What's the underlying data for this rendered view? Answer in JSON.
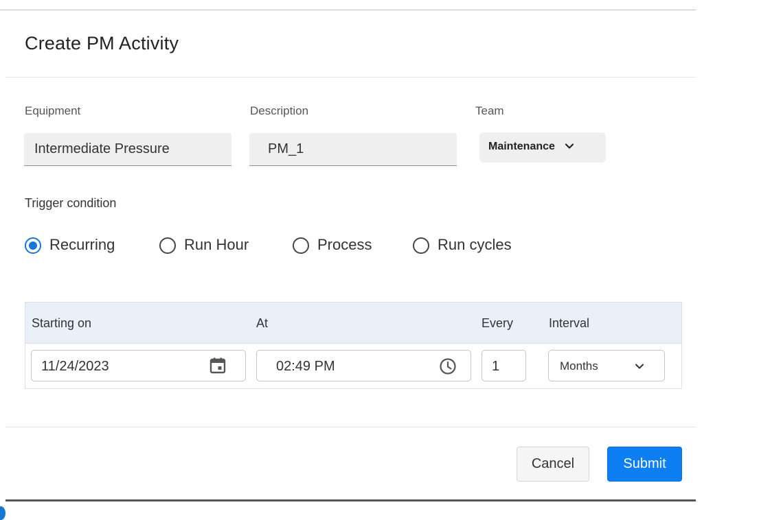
{
  "dialog": {
    "title": "Create PM Activity"
  },
  "form": {
    "equipment": {
      "label": "Equipment",
      "value": "Intermediate Pressure"
    },
    "description": {
      "label": "Description",
      "value": "PM_1"
    },
    "team": {
      "label": "Team",
      "value": "Maintenance"
    }
  },
  "trigger": {
    "label": "Trigger condition",
    "options": [
      {
        "label": "Recurring",
        "checked": true
      },
      {
        "label": "Run Hour",
        "checked": false
      },
      {
        "label": "Process",
        "checked": false
      },
      {
        "label": "Run cycles",
        "checked": false
      }
    ]
  },
  "schedule": {
    "headers": {
      "starting_on": "Starting on",
      "at": "At",
      "every": "Every",
      "interval": "Interval"
    },
    "starting_on": "11/24/2023",
    "at": "02:49 PM",
    "every": "1",
    "interval": "Months"
  },
  "actions": {
    "cancel_label": "Cancel",
    "submit_label": "Submit"
  },
  "icons": {
    "team_dropdown": "chevron-down-icon",
    "date": "calendar-icon",
    "time": "clock-icon",
    "interval_dropdown": "chevron-down-icon"
  },
  "colors": {
    "accent": "#1976d2",
    "submit": "#0d7ff2",
    "header_bg": "#e9f0f9",
    "field_bg": "#efefef"
  }
}
